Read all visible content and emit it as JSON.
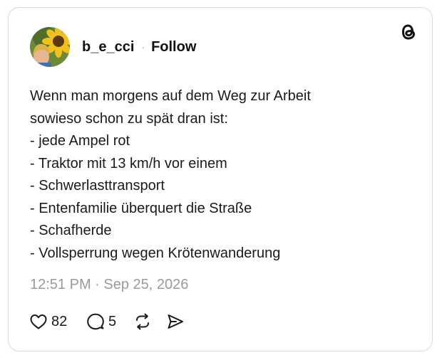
{
  "post": {
    "username": "b_e_cci",
    "separator": "·",
    "follow_label": "Follow",
    "body_lines": [
      "Wenn man morgens auf dem Weg zur Arbeit",
      "sowieso schon zu spät dran ist:",
      "- jede Ampel rot",
      "- Traktor mit 13 km/h vor einem",
      "- Schwerlasttransport",
      "- Entenfamilie überquert die Straße",
      "- Schafherde",
      "- Vollsperrung wegen Krötenwanderung"
    ],
    "timestamp": "12:51 PM · Sep 25, 2026",
    "likes": "82",
    "replies": "5"
  },
  "icons": {
    "brand": "threads-logo-icon",
    "like": "heart-icon",
    "reply": "comment-bubble-icon",
    "repost": "repost-icon",
    "share": "send-icon"
  },
  "colors": {
    "text": "#1a1a1a",
    "muted": "#9a9a9a",
    "border": "#d9d9d9",
    "background": "#ffffff"
  }
}
